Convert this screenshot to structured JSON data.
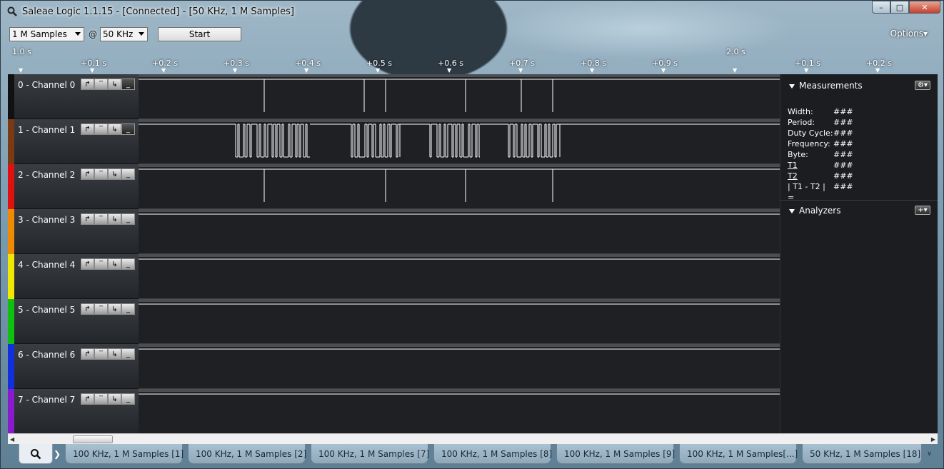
{
  "window": {
    "title": "Saleae Logic 1.1.15 - [Connected] - [50 KHz, 1 M Samples]",
    "controls": {
      "minimize": "–",
      "maximize": "□",
      "close": "✕"
    }
  },
  "toolbar": {
    "samples_value": "1 M Samples",
    "at_label": "@",
    "rate_value": "50 KHz",
    "start_label": "Start",
    "options_label": "Options▾"
  },
  "timeline": {
    "start_label": "1.0 s",
    "mid_label": "2.0 s",
    "ticks": [
      "+0.1 s",
      "+0.2 s",
      "+0.3 s",
      "+0.4 s",
      "+0.5 s",
      "+0.6 s",
      "+0.7 s",
      "+0.8 s",
      "+0.9 s",
      "+0.1 s",
      "+0.2 s"
    ]
  },
  "channels": [
    {
      "name": "0 - Channel 0",
      "color": "#111111"
    },
    {
      "name": "1 - Channel 1",
      "color": "#7a3b12"
    },
    {
      "name": "2 - Channel 2",
      "color": "#e01010"
    },
    {
      "name": "3 - Channel 3",
      "color": "#f08a00"
    },
    {
      "name": "4 - Channel 4",
      "color": "#f0e800"
    },
    {
      "name": "5 - Channel 5",
      "color": "#10c010"
    },
    {
      "name": "6 - Channel 6",
      "color": "#1030e0"
    },
    {
      "name": "7 - Channel 7",
      "color": "#8a1ad0"
    }
  ],
  "measurements": {
    "title": "Measurements",
    "rows": [
      {
        "key": "Width:",
        "value": "###"
      },
      {
        "key": "Period:",
        "value": "###"
      },
      {
        "key": "Duty Cycle:",
        "value": "###"
      },
      {
        "key": "Frequency:",
        "value": "###"
      },
      {
        "key": "Byte:",
        "value": "###"
      },
      {
        "key": "T1",
        "value": "###"
      },
      {
        "key": "T2",
        "value": "###"
      },
      {
        "key": "| T1 - T2 | =",
        "value": "###"
      }
    ]
  },
  "analyzers": {
    "title": "Analyzers"
  },
  "tabs": [
    "100 KHz, 1 M Samples [1]",
    "100 KHz, 1 M Samples [2]",
    "100 KHz, 1 M Samples [7]",
    "100 KHz, 1 M Samples [8]",
    "100 KHz, 1 M Samples [9]",
    "100 KHz, 1 M Samples[...]",
    "50 KHz, 1 M Samples [18]"
  ],
  "colors": {
    "panel_bg": "#1b1d21",
    "wave": "#ffffff",
    "tab_bg": "#9fb8c9"
  }
}
